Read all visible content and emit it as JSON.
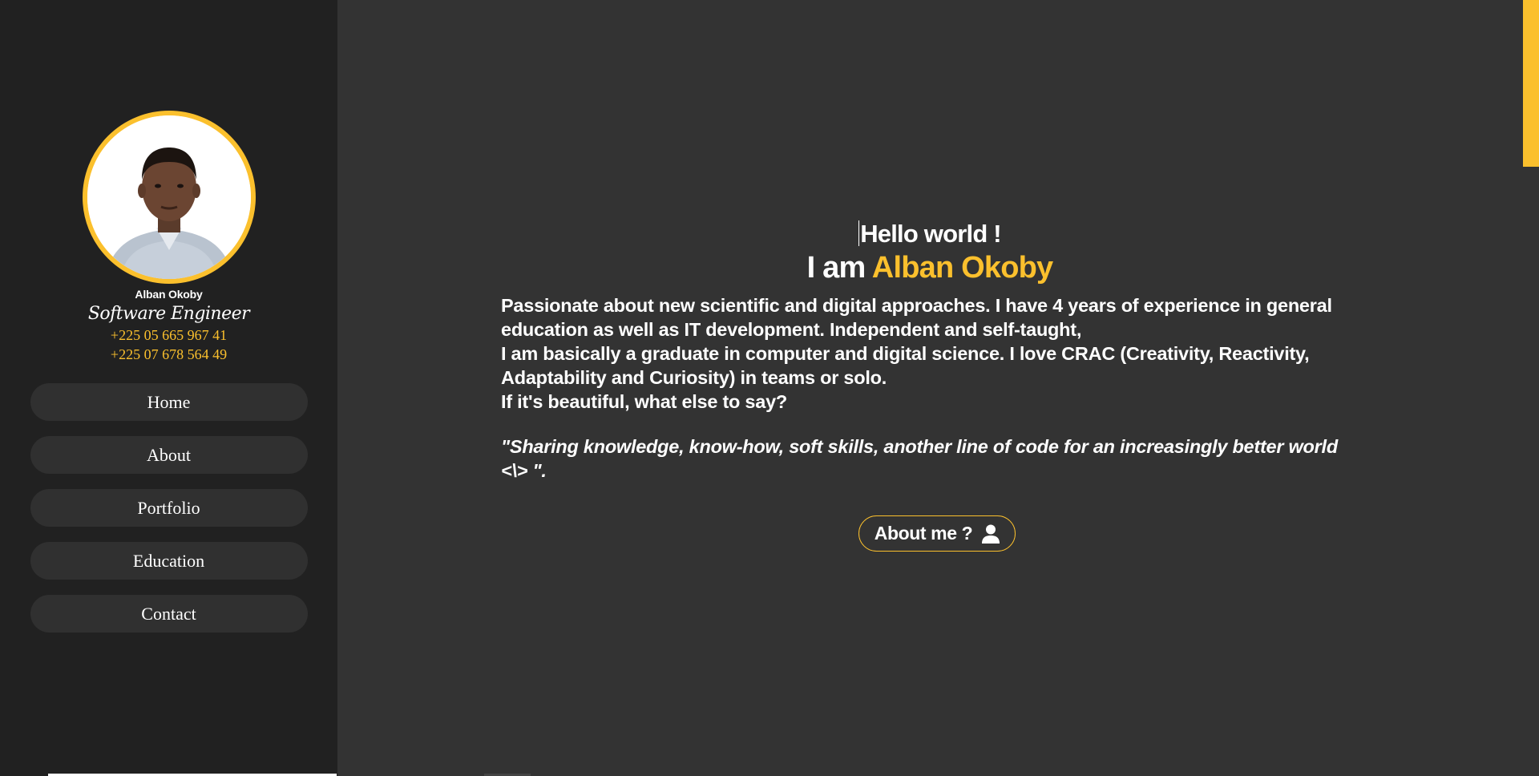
{
  "profile": {
    "name": "Alban Okoby",
    "role": "Software Engineer",
    "phones": [
      "+225 05 665 967 41",
      "+225 07 678 564 49"
    ]
  },
  "nav": {
    "items": [
      {
        "label": "Home"
      },
      {
        "label": "About"
      },
      {
        "label": "Portfolio"
      },
      {
        "label": "Education"
      },
      {
        "label": "Contact"
      }
    ]
  },
  "hero": {
    "greeting": "Hello world !",
    "iam_prefix": "I am ",
    "iam_name": "Alban Okoby",
    "bio_line1_a": "Passionate about new scientific and digital approaches. I have ",
    "bio_years": "4",
    "bio_line1_b": " years of experience in general education as well as IT development. Independent and self-taught,",
    "bio_line2": "I am basically a graduate in computer and digital science. I love CRAC (Creativity, Reactivity, Adaptability and Curiosity) in teams or solo.",
    "bio_line3": "If it's beautiful, what else to say?",
    "quote": "\"Sharing knowledge, know-how, soft skills, another line of code for an increasingly better world <\\> \".",
    "about_button": "About me ?"
  },
  "colors": {
    "accent": "#fbc02d",
    "sidebar_bg": "#212121",
    "main_bg": "#333333",
    "nav_bg": "#303030"
  },
  "icons": {
    "about_button_icon": "user-icon"
  }
}
